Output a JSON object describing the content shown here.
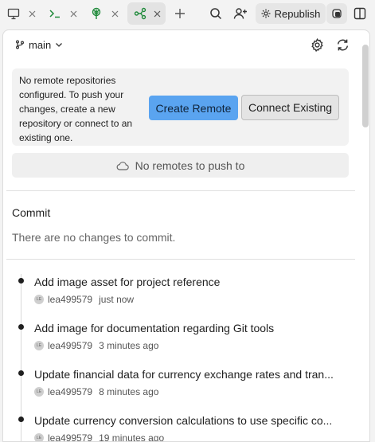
{
  "topbar": {
    "tabs": [
      {
        "icon": "monitor-icon",
        "active": false
      },
      {
        "icon": "terminal-icon",
        "active": false
      },
      {
        "icon": "tree-icon",
        "active": false
      },
      {
        "icon": "git-branch-icon",
        "active": true
      }
    ],
    "republish_label": "Republish",
    "colors": {
      "terminal": "#1f8a3a",
      "tree": "#1f8a3a",
      "git": "#1f8a3a"
    }
  },
  "git": {
    "branch": "main",
    "remote": {
      "message": "No remote repositories configured. To push your changes, create a new repository or connect to an existing one.",
      "create_label": "Create Remote",
      "connect_label": "Connect Existing",
      "no_remotes_label": "No remotes to push to"
    },
    "commit": {
      "title": "Commit",
      "empty_message": "There are no changes to commit."
    },
    "history": [
      {
        "title": "Add image asset for project reference",
        "author": "lea499579",
        "time": "just now",
        "avatar": "LE"
      },
      {
        "title": "Add image for documentation regarding Git tools",
        "author": "lea499579",
        "time": "3 minutes ago",
        "avatar": "LE"
      },
      {
        "title": "Update financial data for currency exchange rates and tran...",
        "author": "lea499579",
        "time": "8 minutes ago",
        "avatar": "LE"
      },
      {
        "title": "Update currency conversion calculations to use specific co...",
        "author": "lea499579",
        "time": "19 minutes ago",
        "avatar": "LE"
      }
    ]
  }
}
